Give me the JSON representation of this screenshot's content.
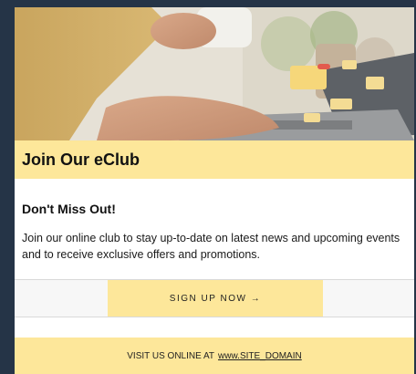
{
  "hero": {
    "image": "person-typing-on-laptop-with-coffee-mug"
  },
  "heading": {
    "title": "Join Our eClub"
  },
  "content": {
    "subheading": "Don't Miss Out!",
    "description": "Join our online club to stay up-to-date on latest news and upcoming events and to receive exclusive offers and promotions."
  },
  "cta": {
    "label": "SIGN UP NOW →"
  },
  "footer": {
    "prefix": "VISIT US ONLINE AT",
    "link": "www.SITE_DOMAIN"
  },
  "colors": {
    "accent": "#fde79a",
    "page_background": "#253447",
    "card": "#ffffff"
  }
}
